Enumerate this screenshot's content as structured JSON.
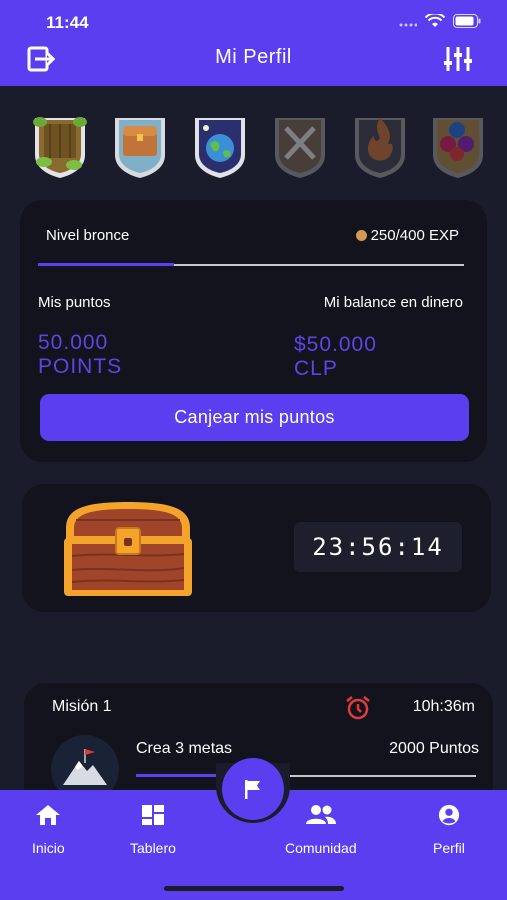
{
  "status": {
    "time": "11:44"
  },
  "header": {
    "title": "Mi Perfil",
    "exit_icon": "exit-icon",
    "settings_icon": "sliders-icon"
  },
  "badges": [
    {
      "name": "forest-badge",
      "unlocked": true
    },
    {
      "name": "chest-badge",
      "unlocked": true
    },
    {
      "name": "earth-badge",
      "unlocked": true
    },
    {
      "name": "swords-badge",
      "unlocked": false
    },
    {
      "name": "fire-badge",
      "unlocked": false
    },
    {
      "name": "gems-badge",
      "unlocked": false
    }
  ],
  "level": {
    "label": "Nivel bronce",
    "exp_text": "250/400 EXP",
    "progress": 0.32
  },
  "points": {
    "label": "Mis puntos",
    "value": "50.000",
    "unit": "POINTS"
  },
  "balance": {
    "label": "Mi balance en dinero",
    "value": "$50.000",
    "unit": "CLP"
  },
  "redeem_button": "Canjear mis puntos",
  "chest_timer": "23:56:14",
  "mission": {
    "title": "Misión 1",
    "time_left": "10h:36m",
    "task": "Crea 3 metas",
    "reward": "2000 Puntos",
    "progress": 0.34
  },
  "nav": {
    "items": [
      {
        "label": "Inicio",
        "icon": "home-icon"
      },
      {
        "label": "Tablero",
        "icon": "dashboard-icon"
      },
      {
        "label": "Comunidad",
        "icon": "people-icon"
      },
      {
        "label": "Perfil",
        "icon": "account-icon"
      }
    ],
    "center_icon": "flag-icon"
  },
  "colors": {
    "primary": "#5a3ef0",
    "background": "#1b1c2b",
    "card": "#12131d",
    "accent_text": "#5b46e6"
  }
}
